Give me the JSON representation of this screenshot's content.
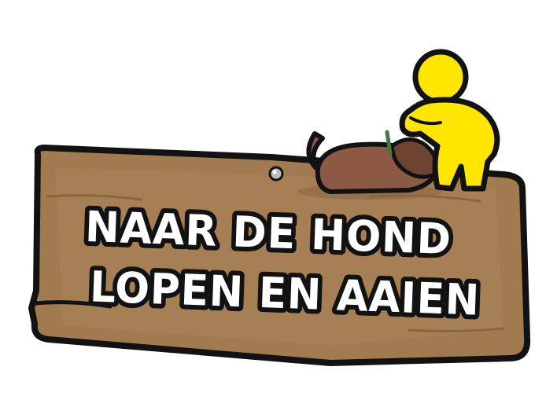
{
  "sign": {
    "line1": "NAAR DE HOND",
    "line2": "LOPEN EN AAIEN"
  },
  "colors": {
    "wood": "#a27a4f",
    "wood_dark": "#8a6540",
    "wood_light": "#b58c5f",
    "outline": "#121212",
    "figure": "#ffe600",
    "dog": "#8c5a44",
    "dog_dark": "#6d4331",
    "nail": "#bdbdbd",
    "leash": "#3f7a3a"
  },
  "icons": [
    "yellow-person-figure",
    "dog-figure",
    "nail"
  ]
}
